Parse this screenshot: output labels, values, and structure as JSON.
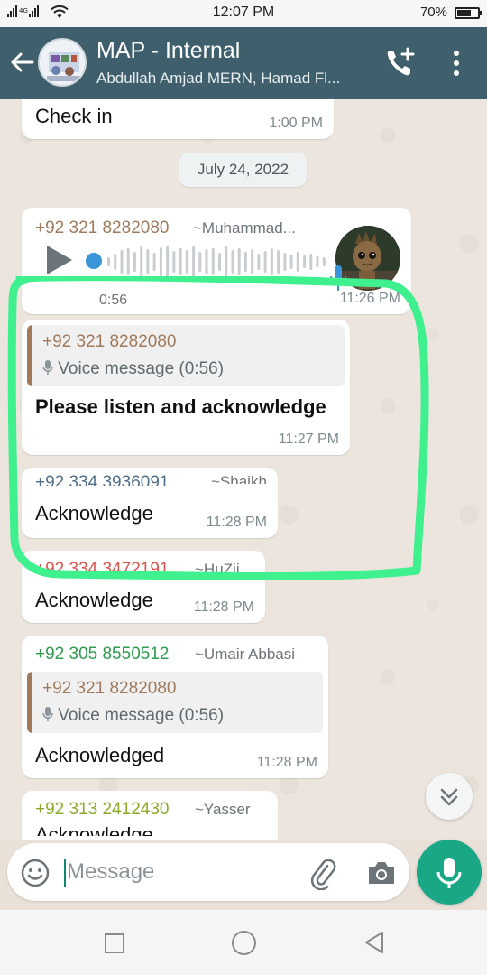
{
  "status_bar": {
    "time": "12:07 PM",
    "battery_text": "70%",
    "battery_level": 0.7,
    "network_label": "4G"
  },
  "header": {
    "title": "MAP - Internal",
    "subtitle": "Abdullah Amjad MERN, Hamad Fl..."
  },
  "chat": {
    "top_partial": {
      "text": "Check in",
      "time": "1:00 PM"
    },
    "date_chip": "July 24, 2022",
    "voice_message": {
      "sender": "+92 321 8282080",
      "alias": "~Muhammad...",
      "duration": "0:56",
      "time": "11:26 PM",
      "sender_color": "#a07a5c"
    },
    "reply_1": {
      "quote_sender": "+92 321 8282080",
      "quote_text": "Voice message (0:56)",
      "text": "Please listen and acknowledge",
      "time": "11:27 PM"
    },
    "msg_2": {
      "sender_partial": "+92 334 3936091",
      "alias_partial": "~Shaikh",
      "text": "Acknowledge",
      "time": "11:28 PM"
    },
    "msg_3": {
      "sender": "+92 334 3472191",
      "alias": "~HuZii",
      "text": "Acknowledge",
      "time": "11:28 PM",
      "sender_color": "#d9534f"
    },
    "msg_4": {
      "sender": "+92 305 8550512",
      "alias": "~Umair Abbasi",
      "quote_sender": "+92 321 8282080",
      "quote_text": "Voice message (0:56)",
      "text": "Acknowledged",
      "time": "11:28 PM",
      "sender_color": "#2e9c4f"
    },
    "msg_5": {
      "sender": "+92 313 2412430",
      "alias": "~Yasser",
      "text_partial": "Acknowledge",
      "sender_color": "#8aab2a"
    }
  },
  "composer": {
    "placeholder": "Message"
  },
  "icons": {
    "back": "arrow-left-icon",
    "call_add": "call-add-icon",
    "more": "more-vertical-icon",
    "play": "play-icon",
    "emoji": "emoji-icon",
    "attach": "paperclip-icon",
    "camera": "camera-icon",
    "mic": "microphone-icon",
    "scroll": "double-chevron-down-icon"
  },
  "colors": {
    "header": "#3f5f6d",
    "accent": "#1aa786",
    "highlight_stroke": "#3ef08e"
  }
}
